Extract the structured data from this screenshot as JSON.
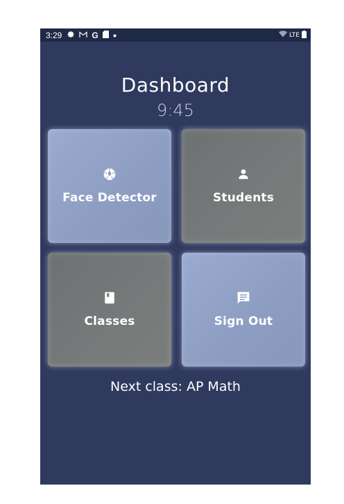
{
  "status_bar": {
    "time": "3:29",
    "icons": [
      "settings-icon",
      "gmail-icon",
      "google-icon",
      "sd-card-icon",
      "dot-icon"
    ],
    "network_label": "LTE",
    "battery": "battery-icon"
  },
  "header": {
    "title": "Dashboard",
    "clock": "9:45"
  },
  "tiles": [
    {
      "label": "Face Detector",
      "icon": "camera-aperture-icon",
      "color": "#9aaad0"
    },
    {
      "label": "Students",
      "icon": "person-icon",
      "color": "#737676"
    },
    {
      "label": "Classes",
      "icon": "book-icon",
      "color": "#737676"
    },
    {
      "label": "Sign Out",
      "icon": "chat-icon",
      "color": "#9aaad0"
    }
  ],
  "footer": {
    "next_class": "Next class: AP Math"
  },
  "colors": {
    "background": "#2f3a5e",
    "status_bar": "#1f2a47",
    "accent_tile": "#9aaad0",
    "neutral_tile": "#737676"
  }
}
